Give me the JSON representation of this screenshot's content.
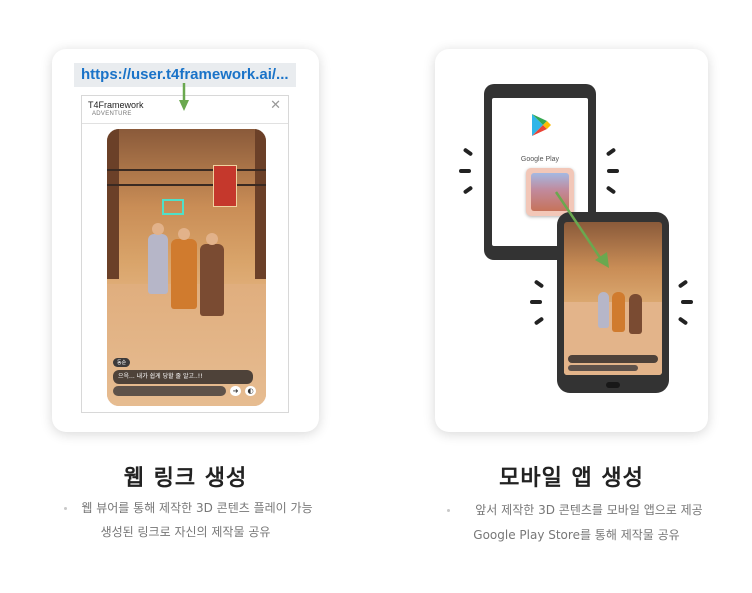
{
  "web": {
    "url": "https://user.t4framework.ai/...",
    "browser_title": "T4Framework",
    "browser_subtitle": "ADVENTURE",
    "close_glyph": "✕",
    "game_tag": "동순",
    "game_chat": "으윽... 내가 쉽게 당할 줄 알고..!!",
    "title": "웹 링크 생성",
    "desc_line1": "웹 뷰어를 통해 제작한 3D 콘텐츠 플레이 가능",
    "desc_line2": "생성된 링크로 자신의 제작물 공유"
  },
  "mobile": {
    "store_label": "Google Play",
    "title": "모바일 앱 생성",
    "desc_line1": "앞서 제작한 3D 콘텐츠를 모바일 앱으로 제공",
    "desc_line2": "Google Play Store를 통해 제작물 공유"
  },
  "icons": {
    "arrow": "green-arrow-icon",
    "store": "google-play-icon",
    "vibration": "vibration-lines-icon"
  },
  "colors": {
    "url_text": "#1a73c8",
    "arrow": "#6aa84f",
    "device": "#333333"
  }
}
